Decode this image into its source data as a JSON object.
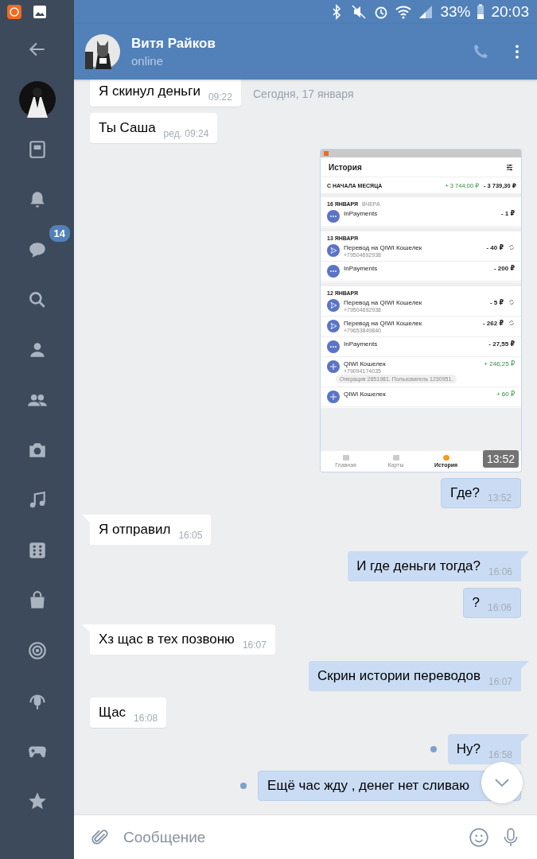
{
  "status_bar": {
    "battery": "33%",
    "time": "20:03"
  },
  "sidebar": {
    "message_badge": "14"
  },
  "header": {
    "name": "Витя Райков",
    "status": "online"
  },
  "date_label": "Сегодня, 17 января",
  "messages": [
    {
      "kind": "text",
      "outgoing": false,
      "text": "Я скинул деньги",
      "time": "09:22",
      "tail": false,
      "unread": false
    },
    {
      "kind": "text",
      "outgoing": false,
      "text": "Ты Саша",
      "time": "ред. 09:24",
      "tail": false,
      "unread": false
    },
    {
      "kind": "screenshot",
      "outgoing": true,
      "time": "13:52",
      "screen": {
        "title": "История",
        "summary": {
          "label": "С НАЧАЛА МЕСЯЦА",
          "income": "+ 3 744,00 ₽",
          "expense": "- 3 739,30 ₽"
        },
        "groups": [
          {
            "date": "16 ЯНВАРЯ",
            "note": "ВЧЕРА",
            "items": [
              {
                "kind": "payment",
                "title": "InPayments",
                "amount": "- 1 ₽",
                "positive": false,
                "repeat": false
              }
            ]
          },
          {
            "date": "13 ЯНВАРЯ",
            "items": [
              {
                "kind": "transfer",
                "title": "Перевод на QIWI Кошелек",
                "phone": "+79504692938",
                "amount": "- 40 ₽",
                "positive": false,
                "repeat": true
              },
              {
                "kind": "payment",
                "title": "InPayments",
                "amount": "- 200 ₽",
                "positive": false,
                "repeat": false
              }
            ]
          },
          {
            "date": "12 ЯНВАРЯ",
            "items": [
              {
                "kind": "transfer",
                "title": "Перевод на QIWI Кошелек",
                "phone": "+79504692938",
                "amount": "- 5 ₽",
                "positive": false,
                "repeat": true
              },
              {
                "kind": "transfer",
                "title": "Перевод на QIWI Кошелек",
                "phone": "+79653849840",
                "amount": "- 262 ₽",
                "positive": false,
                "repeat": true
              },
              {
                "kind": "payment",
                "title": "InPayments",
                "amount": "- 27,55 ₽",
                "positive": false,
                "repeat": false
              },
              {
                "kind": "topup",
                "title": "QIWI Кошелек",
                "phone": "+79094174035",
                "comment": "Операция 2851981. Пользователь 1230951.",
                "amount": "+ 246,25 ₽",
                "positive": true,
                "repeat": false
              },
              {
                "kind": "topup",
                "title": "QIWI Кошелек",
                "amount": "+ 60 ₽",
                "positive": true,
                "repeat": false
              }
            ]
          }
        ],
        "nav": [
          {
            "label": "Главная",
            "selected": false
          },
          {
            "label": "Карты",
            "selected": false
          },
          {
            "label": "История",
            "selected": true
          }
        ]
      }
    },
    {
      "kind": "text",
      "outgoing": true,
      "text": "Где?",
      "time": "13:52",
      "tail": false,
      "unread": false
    },
    {
      "kind": "text",
      "outgoing": false,
      "text": "Я отправил",
      "time": "16:05",
      "tail": true,
      "unread": false
    },
    {
      "kind": "text",
      "outgoing": true,
      "text": "И где деньги тогда?",
      "time": "16:06",
      "tail": true,
      "unread": false
    },
    {
      "kind": "text",
      "outgoing": true,
      "text": "?",
      "time": "16:06",
      "tail": false,
      "unread": false
    },
    {
      "kind": "text",
      "outgoing": false,
      "text": "Хз щас в тех позвоню",
      "time": "16:07",
      "tail": true,
      "unread": false
    },
    {
      "kind": "text",
      "outgoing": true,
      "text": "Скрин истории переводов",
      "time": "16:07",
      "tail": true,
      "unread": false
    },
    {
      "kind": "text",
      "outgoing": false,
      "text": "Щас",
      "time": "16:08",
      "tail": false,
      "unread": false
    },
    {
      "kind": "text",
      "outgoing": true,
      "text": "Ну?",
      "time": "16:58",
      "tail": true,
      "unread": true
    },
    {
      "kind": "text",
      "outgoing": true,
      "text": "Ещё час жду , денег нет сливаю",
      "tail": false,
      "unread": true
    }
  ],
  "composer": {
    "placeholder": "Сообщение"
  }
}
